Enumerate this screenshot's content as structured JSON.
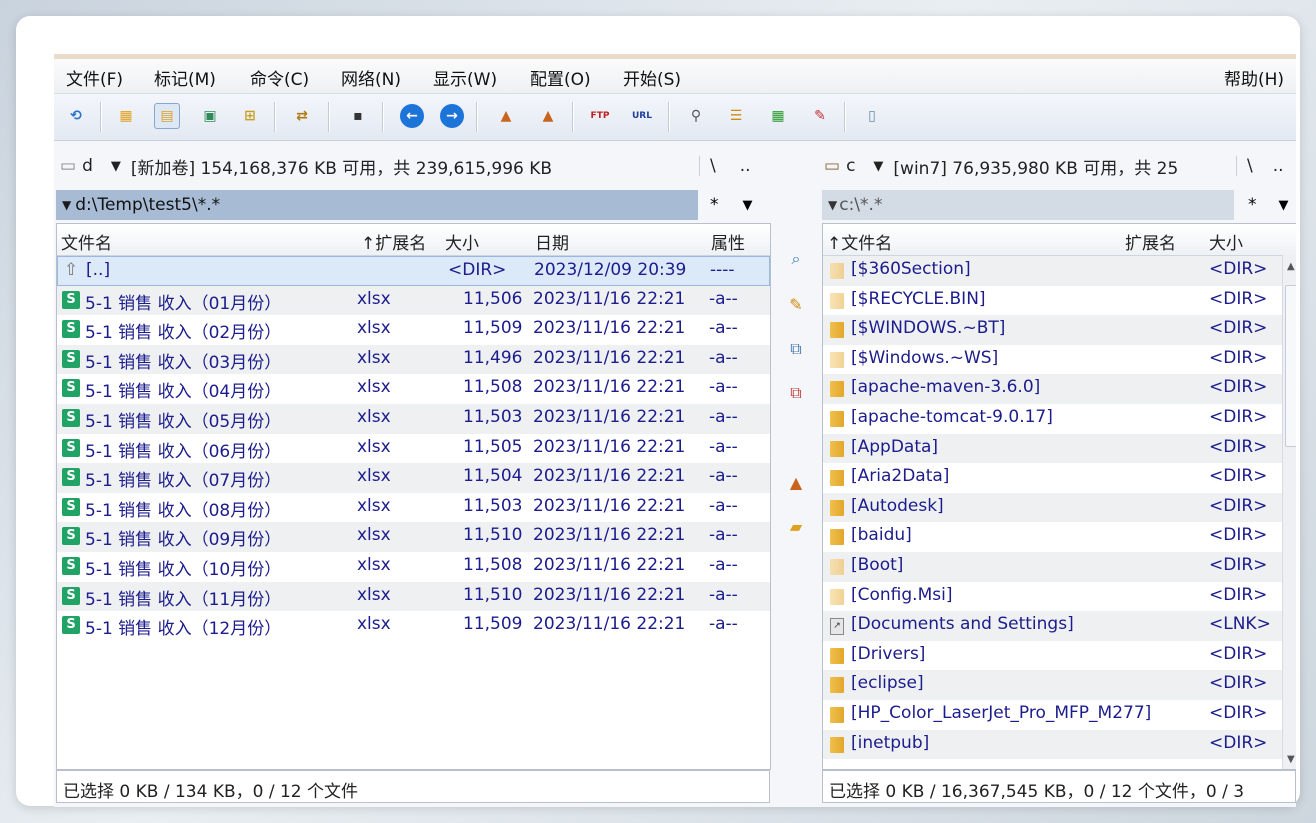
{
  "menu": {
    "file": "文件(F)",
    "mark": "标记(M)",
    "commands": "命令(C)",
    "net": "网络(N)",
    "show": "显示(W)",
    "config": "配置(O)",
    "start": "开始(S)",
    "help": "帮助(H)"
  },
  "toolbar_icons": [
    "refresh-icon",
    "brief-view-icon",
    "full-view-icon",
    "thumbnail-view-icon",
    "tree-view-icon",
    "sync-dirs-icon",
    "console-icon",
    "back-icon",
    "forward-icon",
    "pack-icon",
    "unpack-icon",
    "ftp-icon",
    "url-icon",
    "search-icon",
    "multi-rename-icon",
    "compare-icon",
    "edit-icon",
    "notepad-icon"
  ],
  "toolbar_text": {
    "ftp": "FTP",
    "url": "URL"
  },
  "left": {
    "drive_letter": "d",
    "drive_info": "[新加卷]  154,168,376 KB 可用，共 239,615,996 KB",
    "root_btn": "\\",
    "up_btn": "..",
    "path": "d:\\Temp\\test5\\*.*",
    "filter": "*",
    "headers": {
      "name": "文件名",
      "ext": "↑扩展名",
      "size": "大小",
      "date": "日期",
      "attr": "属性"
    },
    "parent": {
      "name": "[..]",
      "size": "<DIR>",
      "date": "2023/12/09 20:39",
      "attr": "----"
    },
    "files": [
      {
        "name": "5-1  销售 收入（01月份）",
        "ext": "xlsx",
        "size": "11,506",
        "date": "2023/11/16 22:21",
        "attr": "-a--"
      },
      {
        "name": "5-1  销售 收入（02月份）",
        "ext": "xlsx",
        "size": "11,509",
        "date": "2023/11/16 22:21",
        "attr": "-a--"
      },
      {
        "name": "5-1  销售 收入（03月份）",
        "ext": "xlsx",
        "size": "11,496",
        "date": "2023/11/16 22:21",
        "attr": "-a--"
      },
      {
        "name": "5-1  销售 收入（04月份）",
        "ext": "xlsx",
        "size": "11,508",
        "date": "2023/11/16 22:21",
        "attr": "-a--"
      },
      {
        "name": "5-1  销售 收入（05月份）",
        "ext": "xlsx",
        "size": "11,503",
        "date": "2023/11/16 22:21",
        "attr": "-a--"
      },
      {
        "name": "5-1  销售 收入（06月份）",
        "ext": "xlsx",
        "size": "11,505",
        "date": "2023/11/16 22:21",
        "attr": "-a--"
      },
      {
        "name": "5-1  销售 收入（07月份）",
        "ext": "xlsx",
        "size": "11,504",
        "date": "2023/11/16 22:21",
        "attr": "-a--"
      },
      {
        "name": "5-1  销售 收入（08月份）",
        "ext": "xlsx",
        "size": "11,503",
        "date": "2023/11/16 22:21",
        "attr": "-a--"
      },
      {
        "name": "5-1  销售 收入（09月份）",
        "ext": "xlsx",
        "size": "11,510",
        "date": "2023/11/16 22:21",
        "attr": "-a--"
      },
      {
        "name": "5-1  销售 收入（10月份）",
        "ext": "xlsx",
        "size": "11,508",
        "date": "2023/11/16 22:21",
        "attr": "-a--"
      },
      {
        "name": "5-1  销售 收入（11月份）",
        "ext": "xlsx",
        "size": "11,510",
        "date": "2023/11/16 22:21",
        "attr": "-a--"
      },
      {
        "name": "5-1  销售 收入（12月份）",
        "ext": "xlsx",
        "size": "11,509",
        "date": "2023/11/16 22:21",
        "attr": "-a--"
      }
    ],
    "status": "已选择 0 KB / 134 KB，0 / 12 个文件"
  },
  "right": {
    "drive_letter": "c",
    "drive_info": "[win7]  76,935,980 KB 可用，共 25",
    "root_btn": "\\",
    "up_btn": "..",
    "path": "c:\\*.*",
    "filter": "*",
    "headers": {
      "name": "↑文件名",
      "ext": "扩展名",
      "size": "大小"
    },
    "items": [
      {
        "name": "[$360Section]",
        "size": "<DIR>",
        "icon": "folder-hidden"
      },
      {
        "name": "[$RECYCLE.BIN]",
        "size": "<DIR>",
        "icon": "folder-hidden"
      },
      {
        "name": "[$WINDOWS.~BT]",
        "size": "<DIR>",
        "icon": "folder"
      },
      {
        "name": "[$Windows.~WS]",
        "size": "<DIR>",
        "icon": "folder-hidden"
      },
      {
        "name": "[apache-maven-3.6.0]",
        "size": "<DIR>",
        "icon": "folder"
      },
      {
        "name": "[apache-tomcat-9.0.17]",
        "size": "<DIR>",
        "icon": "folder"
      },
      {
        "name": "[AppData]",
        "size": "<DIR>",
        "icon": "folder"
      },
      {
        "name": "[Aria2Data]",
        "size": "<DIR>",
        "icon": "folder"
      },
      {
        "name": "[Autodesk]",
        "size": "<DIR>",
        "icon": "folder"
      },
      {
        "name": "[baidu]",
        "size": "<DIR>",
        "icon": "folder"
      },
      {
        "name": "[Boot]",
        "size": "<DIR>",
        "icon": "folder-hidden"
      },
      {
        "name": "[Config.Msi]",
        "size": "<DIR>",
        "icon": "folder-hidden"
      },
      {
        "name": "[Documents and Settings]",
        "size": "<LNK>",
        "icon": "link"
      },
      {
        "name": "[Drivers]",
        "size": "<DIR>",
        "icon": "folder"
      },
      {
        "name": "[eclipse]",
        "size": "<DIR>",
        "icon": "folder"
      },
      {
        "name": "[HP_Color_LaserJet_Pro_MFP_M277]",
        "size": "<DIR>",
        "icon": "folder"
      },
      {
        "name": "[inetpub]",
        "size": "<DIR>",
        "icon": "folder"
      }
    ],
    "status": "已选择 0 KB / 16,367,545 KB，0 / 12 个文件，0 / 3"
  },
  "middle_icons": [
    "view-icon",
    "edit-file-icon",
    "copy-icon",
    "move-icon",
    "pack-files-icon",
    "new-folder-icon"
  ]
}
